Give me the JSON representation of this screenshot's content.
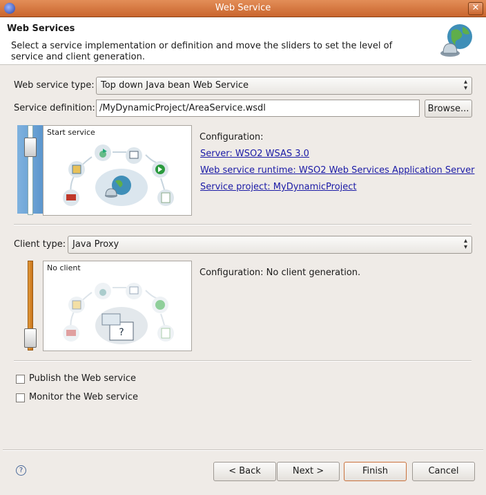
{
  "window": {
    "title": "Web Service"
  },
  "header": {
    "title": "Web Services",
    "description": "Select a service implementation or definition and move the sliders to set the level of service and client generation."
  },
  "service": {
    "type_label": "Web service type:",
    "type_value": "Top down Java bean Web Service",
    "definition_label": "Service definition:",
    "definition_value": "/MyDynamicProject/AreaService.wsdl",
    "browse_label": "Browse...",
    "slider_caption": "Start service",
    "config_label": "Configuration:",
    "server_link": "Server: WSO2 WSAS 3.0",
    "runtime_link": "Web service runtime: WSO2 Web Services Application Server",
    "project_link": "Service project: MyDynamicProject"
  },
  "client": {
    "type_label": "Client type:",
    "type_value": "Java Proxy",
    "slider_caption": "No client",
    "config_text": "Configuration: No client generation."
  },
  "options": {
    "publish_label": "Publish the Web service",
    "monitor_label": "Monitor the Web service"
  },
  "buttons": {
    "back": "< Back",
    "next": "Next >",
    "finish": "Finish",
    "cancel": "Cancel"
  },
  "icons": {
    "help": "help-icon",
    "globe": "globe-bell-icon"
  },
  "colors": {
    "titlebar": "#d5763e",
    "link": "#1a1aa6"
  }
}
